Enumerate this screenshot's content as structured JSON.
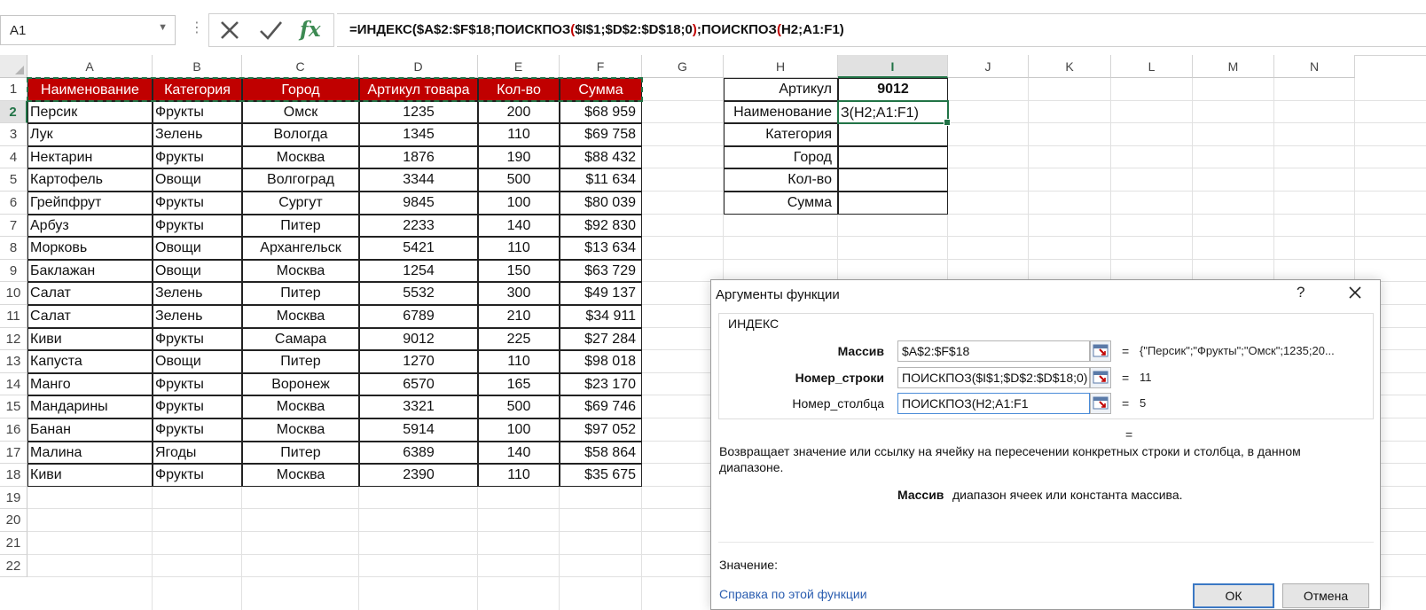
{
  "name_box": {
    "value": "A1"
  },
  "formula_bar": {
    "segments": [
      {
        "text": "=ИНДЕКС($A$2:$F$18;ПОИСКПОЗ",
        "color": "#111111"
      },
      {
        "text": "(",
        "color": "#c00000"
      },
      {
        "text": "$I$1;$D$2:$D$18;0",
        "color": "#111111"
      },
      {
        "text": ")",
        "color": "#c00000"
      },
      {
        "text": ";ПОИСКПОЗ",
        "color": "#111111"
      },
      {
        "text": "(",
        "color": "#c00000"
      },
      {
        "text": "H2;A1:F1)",
        "color": "#111111"
      }
    ]
  },
  "columns": [
    "A",
    "B",
    "C",
    "D",
    "E",
    "F",
    "G",
    "H",
    "I",
    "J",
    "K",
    "L",
    "M",
    "N"
  ],
  "selected_column": "I",
  "rows": [
    "1",
    "2",
    "3",
    "4",
    "5",
    "6",
    "7",
    "8",
    "9",
    "10",
    "11",
    "12",
    "13",
    "14",
    "15",
    "16",
    "17",
    "18",
    "19",
    "20",
    "21",
    "22"
  ],
  "selected_row": "2",
  "table": {
    "headers": [
      "Наименование",
      "Категория",
      "Город",
      "Артикул товара",
      "Кол-во",
      "Сумма"
    ],
    "header_color": "#c00000",
    "rows": [
      [
        "Персик",
        "Фрукты",
        "Омск",
        "1235",
        "200",
        "$68 959"
      ],
      [
        "Лук",
        "Зелень",
        "Вологда",
        "1345",
        "110",
        "$69 758"
      ],
      [
        "Нектарин",
        "Фрукты",
        "Москва",
        "1876",
        "190",
        "$88 432"
      ],
      [
        "Картофель",
        "Овощи",
        "Волгоград",
        "3344",
        "500",
        "$11 634"
      ],
      [
        "Грейпфрут",
        "Фрукты",
        "Сургут",
        "9845",
        "100",
        "$80 039"
      ],
      [
        "Арбуз",
        "Фрукты",
        "Питер",
        "2233",
        "140",
        "$92 830"
      ],
      [
        "Морковь",
        "Овощи",
        "Архангельск",
        "5421",
        "110",
        "$13 634"
      ],
      [
        "Баклажан",
        "Овощи",
        "Москва",
        "1254",
        "150",
        "$63 729"
      ],
      [
        "Салат",
        "Зелень",
        "Питер",
        "5532",
        "300",
        "$49 137"
      ],
      [
        "Салат",
        "Зелень",
        "Москва",
        "6789",
        "210",
        "$34 911"
      ],
      [
        "Киви",
        "Фрукты",
        "Самара",
        "9012",
        "225",
        "$27 284"
      ],
      [
        "Капуста",
        "Овощи",
        "Питер",
        "1270",
        "110",
        "$98 018"
      ],
      [
        "Манго",
        "Фрукты",
        "Воронеж",
        "6570",
        "165",
        "$23 170"
      ],
      [
        "Мандарины",
        "Фрукты",
        "Москва",
        "3321",
        "500",
        "$69 746"
      ],
      [
        "Банан",
        "Фрукты",
        "Москва",
        "5914",
        "100",
        "$97 052"
      ],
      [
        "Малина",
        "Ягоды",
        "Питер",
        "6389",
        "140",
        "$58 864"
      ],
      [
        "Киви",
        "Фрукты",
        "Москва",
        "2390",
        "110",
        "$35 675"
      ]
    ]
  },
  "lookup": {
    "labels": [
      "Артикул",
      "Наименование",
      "Категория",
      "Город",
      "Кол-во",
      "Сумма"
    ],
    "article_value": "9012",
    "active_cell_text": "З(H2;A1:F1)"
  },
  "dialog": {
    "title": "Аргументы функции",
    "help": "?",
    "function_name": "ИНДЕКС",
    "args": [
      {
        "label": "Массив",
        "input": "$A$2:$F$18",
        "eq": "=",
        "result": "{\"Персик\";\"Фрукты\";\"Омск\";1235;20..."
      },
      {
        "label": "Номер_строки",
        "input": "ПОИСКПОЗ($I$1;$D$2:$D$18;0)",
        "eq": "=",
        "result": "11"
      },
      {
        "label": "Номер_столбца",
        "input": "ПОИСКПОЗ(H2;A1:F1",
        "eq": "=",
        "result": "5"
      }
    ],
    "eq_alone": "=",
    "description": "Возвращает значение или ссылку на ячейку на пересечении конкретных строки и столбца, в данном диапазоне.",
    "arg_desc_name": "Массив",
    "arg_desc_text": "диапазон ячеек или константа массива.",
    "value_label": "Значение:",
    "help_link": "Справка по этой функции",
    "ok": "ОК",
    "cancel": "Отмена"
  }
}
